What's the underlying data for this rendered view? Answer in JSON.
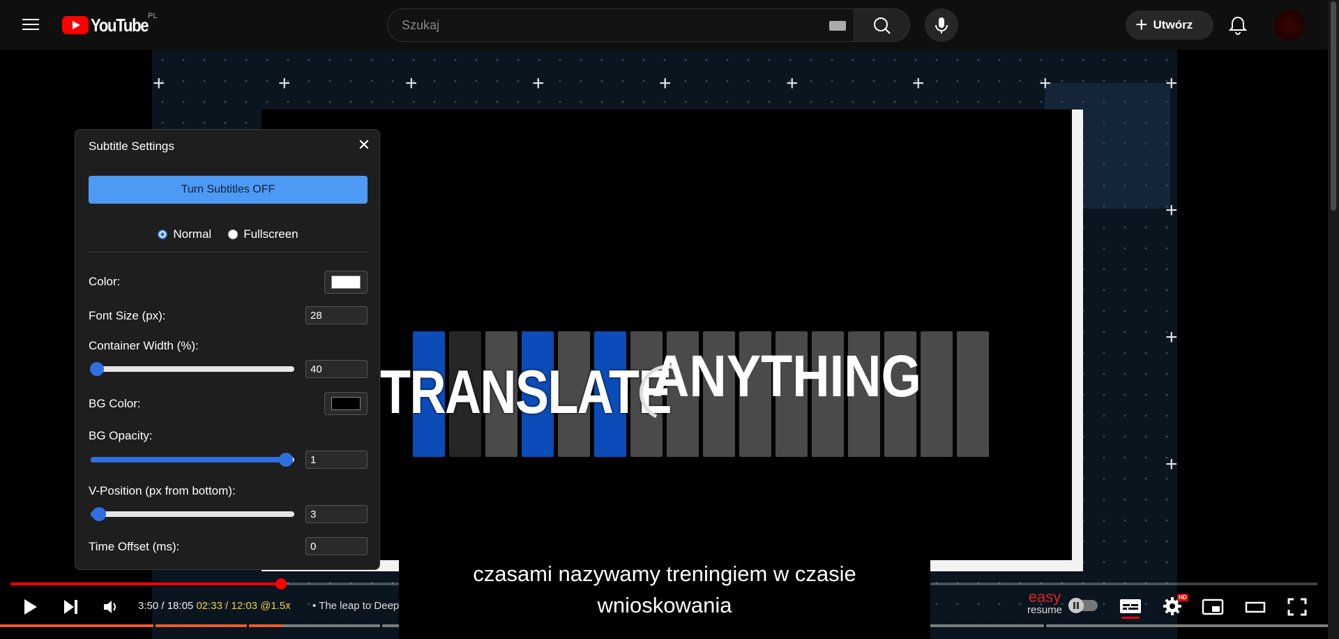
{
  "header": {
    "logo_text": "YouTube",
    "region": "PL",
    "search_placeholder": "Szukaj",
    "create_label": "Utwórz"
  },
  "video": {
    "title_word_1": "TRANSLATE",
    "title_word_2": "ANYTHING"
  },
  "subtitle_panel": {
    "title": "Subtitle Settings",
    "close_glyph": "✕",
    "toggle_label": "Turn Subtitles OFF",
    "mode_options": [
      {
        "label": "Normal",
        "checked": true
      },
      {
        "label": "Fullscreen",
        "checked": false
      }
    ],
    "color_label": "Color:",
    "color_value": "#ffffff",
    "font_size_label": "Font Size (px):",
    "font_size_value": "28",
    "width_label": "Container Width (%):",
    "width_value": "40",
    "width_slider_fraction": 0.03,
    "bg_color_label": "BG Color:",
    "bg_color_value": "#000000",
    "bg_opacity_label": "BG Opacity:",
    "bg_opacity_value": "1",
    "bg_opacity_slider_fraction": 0.96,
    "vpos_label": "V-Position (px from bottom):",
    "vpos_value": "3",
    "vpos_slider_fraction": 0.04,
    "offset_label": "Time Offset (ms):",
    "offset_value": "0"
  },
  "subtitle_text": {
    "line1": "czasami nazywamy treningiem w czasie",
    "line2": "wnioskowania"
  },
  "player": {
    "time_current": "3:50",
    "time_sep": " / ",
    "time_total": "18:05",
    "speed_time": "02:33 / 12:03 @1.5x",
    "bullet": "•",
    "video_title": "The leap to Deep",
    "progress_fraction": 0.207,
    "easy_label": "easy",
    "resume_label": "resume",
    "hd_badge": "HD",
    "accent_color": "#ff0000"
  }
}
